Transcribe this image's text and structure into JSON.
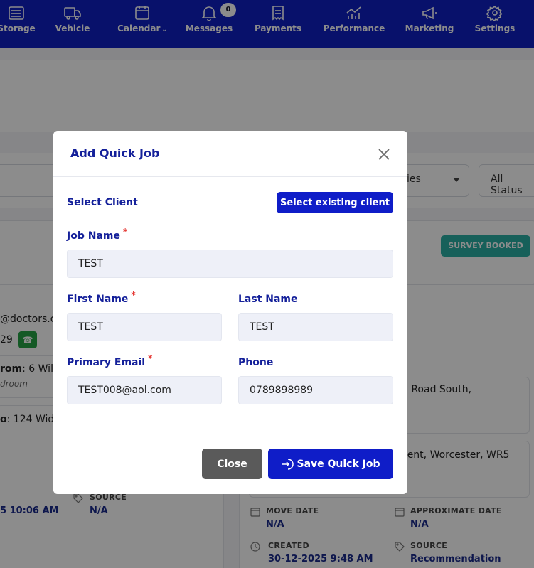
{
  "nav": {
    "items": [
      {
        "label": "Storage",
        "icon": "storage-icon"
      },
      {
        "label": "Vehicle",
        "icon": "truck-icon"
      },
      {
        "label": "Calendar",
        "icon": "calendar-icon"
      },
      {
        "label": "Messages",
        "icon": "bell-icon",
        "badge": "0"
      },
      {
        "label": "Payments",
        "icon": "receipt-icon"
      },
      {
        "label": "Performance",
        "icon": "chart-icon"
      },
      {
        "label": "Marketing",
        "icon": "megaphone-icon"
      },
      {
        "label": "Settings",
        "icon": "gear-icon"
      }
    ]
  },
  "background": {
    "filter_category": "ies",
    "filter_status": "All Status",
    "status_tag": "SURVEY BOOKED",
    "email_fragment": "@doctors.o",
    "phone_fragment": "29",
    "from_label": "rom",
    "from_value": ": 6 Wilf",
    "from_sub": "droom",
    "to_label": "o",
    "to_value": ": 124 Widm",
    "address_1": "d Road South,",
    "address_2": "cent, Worcester, WR5",
    "left_time": "5 10:06 AM",
    "left_source_label": "SOURCE",
    "left_source_value": "N/A",
    "move_date_label": "MOVE DATE",
    "move_date_value": "N/A",
    "approx_date_label": "APPROXIMATE DATE",
    "approx_date_value": "N/A",
    "created_label": "CREATED",
    "created_value": "30-12-2025 9:48 AM",
    "source_label": "SOURCE",
    "source_value": "Recommendation"
  },
  "modal": {
    "title": "Add Quick Job",
    "select_client_label": "Select Client",
    "select_existing_button": "Select existing client",
    "required_mark": "*",
    "fields": {
      "job_name": {
        "label": "Job Name",
        "value": "TEST"
      },
      "first_name": {
        "label": "First Name",
        "value": "TEST"
      },
      "last_name": {
        "label": "Last Name",
        "value": "TEST"
      },
      "primary_email": {
        "label": "Primary Email",
        "value": "TEST008@aol.com"
      },
      "phone": {
        "label": "Phone",
        "value": "0789898989"
      }
    },
    "close_button": "Close",
    "save_button": "Save Quick Job"
  },
  "colors": {
    "nav_bg": "#101fc4",
    "primary": "#0f1dc8",
    "label": "#14209a",
    "tag": "#2bb0a4",
    "required": "#e53935"
  }
}
